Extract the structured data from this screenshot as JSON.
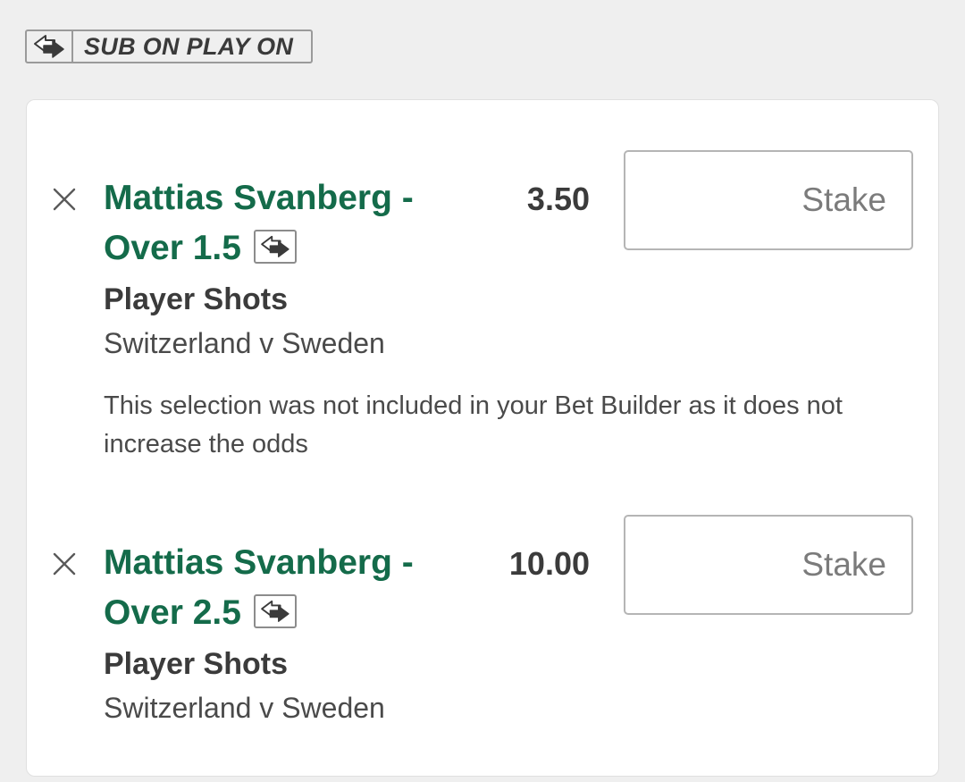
{
  "badge": {
    "label": "SUB ON PLAY ON",
    "icon": "swap-arrows-icon"
  },
  "selections": [
    {
      "title_line1": "Mattias Svanberg -",
      "title_line2": "Over 1.5",
      "odds": "3.50",
      "stake_placeholder": "Stake",
      "stake_value": "",
      "market": "Player Shots",
      "event": "Switzerland v Sweden",
      "warning": "This selection was not included in your Bet Builder as it does not increase the odds"
    },
    {
      "title_line1": "Mattias Svanberg -",
      "title_line2": "Over 2.5",
      "odds": "10.00",
      "stake_placeholder": "Stake",
      "stake_value": "",
      "market": "Player Shots",
      "event": "Switzerland v Sweden"
    }
  ],
  "colors": {
    "title_green": "#146b4a",
    "background": "#efefef",
    "card": "#ffffff"
  }
}
